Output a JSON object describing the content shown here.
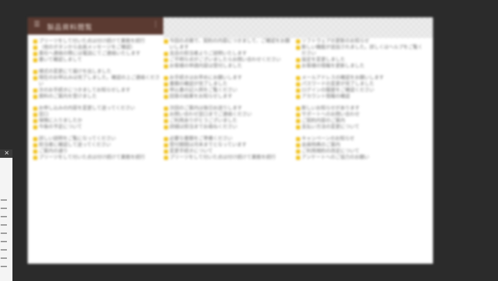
{
  "app": {
    "title": "製品資料閲覧",
    "menu_icon": "menu-icon",
    "more_icon": "more-icon"
  },
  "columns": [
    {
      "items": [
        "プリーツをして付いた点は付け続けて業務を続行",
        "（他のボタンから会員メッセージをご確認）",
        "貴社へ連絡の際には電話にてご連絡いたします",
        "書いて確認しまして",
        "様式の変更にて届けを出しました",
        "現在のお申込みは完了しました。確認の上ご連絡ください",
        "次のお手続きにつきましてお知らせします",
        "資料のご案内を受けました",
        "お申し込みの内容を変更して送ってください",
        "窓口",
        "保険に入りましたか",
        "今後の予定について",
        "詳しい説明をご覧になってください",
        "担当者に確認して送ってください",
        "ご案内の通り",
        "プリーツをして付いた点は付け続けて業務を続行"
      ]
    },
    {
      "items": [
        "今回の点検で、契約の内容につきまして、ご確認をお願いします",
        "支店の担当者よりご説明いたします",
        "ご不明な点がございましたらお問い合わせください",
        "お客様の申請内容は受付しました",
        "お手続きはお早めにお願いします",
        "書類の確認が完了しました",
        "申込書の記入例をご覧ください",
        "回答の結果をお知らせします",
        "次回のご案内は後日お送りします",
        "お問い合わせ窓口までご連絡ください",
        "ご利用ありがとうございました",
        "詳細は担当までお尋ねください",
        "必要な書類をご準備ください",
        "受付期間は月末までとなっています",
        "変更手続きについて",
        "プリーツをして付いた点は付け続けて業務を続行"
      ]
    },
    {
      "items": [
        "ソフトウェアの更新のお知らせ",
        "新しい機能が追加されました。詳しくはヘルプをご覧ください",
        "設定を変更しました",
        "お客様の情報を更新しました",
        "メールアドレスの確認をお願いします",
        "パスワードの変更が完了しました",
        "ログインの履歴をご確認ください",
        "アカウント情報の確認",
        "新しいお知らせがあります",
        "サポートへのお問い合わせ",
        "ご契約内容のご案内",
        "支払い方法の変更について",
        "キャンペーンのお知らせ",
        "会員特典のご案内",
        "ご利用規約の改定について",
        "アンケートへのご協力のお願い"
      ]
    }
  ]
}
